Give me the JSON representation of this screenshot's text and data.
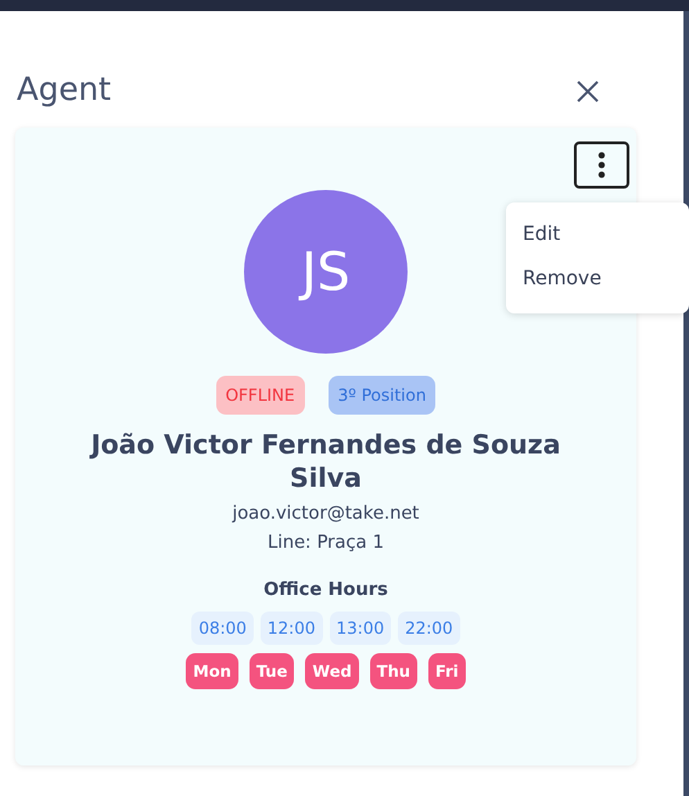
{
  "panel": {
    "title": "Agent"
  },
  "agent": {
    "initials": "JS",
    "status": "OFFLINE",
    "position": "3º Position",
    "name": "João Victor Fernandes de Souza Silva",
    "email": "joao.victor@take.net",
    "line": "Line: Praça 1"
  },
  "menu": {
    "items": [
      "Edit",
      "Remove"
    ]
  },
  "office_hours": {
    "title": "Office Hours",
    "times": [
      "08:00",
      "12:00",
      "13:00",
      "22:00"
    ],
    "days": [
      "Mon",
      "Tue",
      "Wed",
      "Thu",
      "Fri"
    ]
  }
}
